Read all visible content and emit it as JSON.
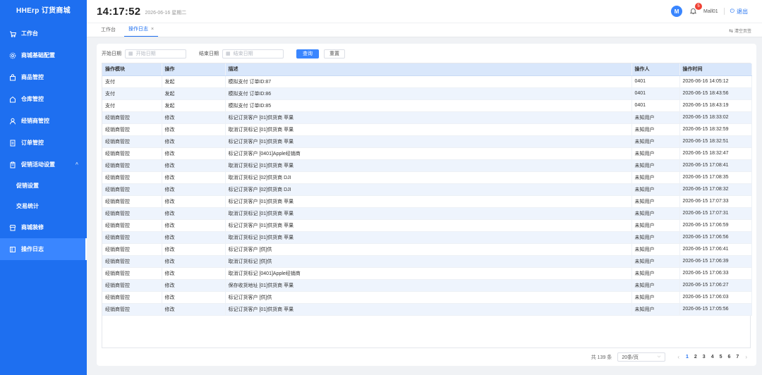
{
  "brand": "HHErp 订货商城",
  "sidebar": {
    "items": [
      {
        "label": "工作台",
        "icon": "cart-icon"
      },
      {
        "label": "商城基础配置",
        "icon": "gear-icon"
      },
      {
        "label": "商品管控",
        "icon": "bag-icon"
      },
      {
        "label": "仓库管控",
        "icon": "house-icon"
      },
      {
        "label": "经销商管控",
        "icon": "user-icon"
      },
      {
        "label": "订单管控",
        "icon": "document-icon"
      },
      {
        "label": "促销活动设置",
        "icon": "clipboard-icon",
        "caret": "^"
      },
      {
        "label": "促销设置"
      },
      {
        "label": "交易统计"
      },
      {
        "label": "商城装修",
        "icon": "store-icon"
      },
      {
        "label": "操作日志",
        "icon": "log-icon"
      }
    ]
  },
  "header": {
    "clock": "14:17:52",
    "date": "2026-06-16 星期二",
    "avatar_letter": "M",
    "notification_count": "5",
    "username": "Mall01",
    "logout_label": "退出"
  },
  "tabs": [
    {
      "label": "工作台"
    },
    {
      "label": "操作日志",
      "close": "×"
    }
  ],
  "clear_tabs_label": "清空页签",
  "filters": {
    "start_label": "开始日期",
    "start_placeholder": "开始日期",
    "end_label": "结束日期",
    "end_placeholder": "结束日期",
    "query_label": "查询",
    "reset_label": "重置"
  },
  "table": {
    "columns": [
      "操作模块",
      "操作",
      "描述",
      "操作人",
      "操作时间"
    ],
    "rows": [
      [
        "支付",
        "发起",
        "模拟支付 订单ID:87",
        "0401",
        "2026-06-16 14:05:12"
      ],
      [
        "支付",
        "发起",
        "模拟支付 订单ID:86",
        "0401",
        "2026-06-15 18:43:56"
      ],
      [
        "支付",
        "发起",
        "模拟支付 订单ID:85",
        "0401",
        "2026-06-15 18:43:19"
      ],
      [
        "经销商管控",
        "修改",
        "标记订货客户 [01]供货商 苹果",
        "未知用户",
        "2026-06-15 18:33:02"
      ],
      [
        "经销商管控",
        "修改",
        "取消订货标记 [01]供货商 苹果",
        "未知用户",
        "2026-06-15 18:32:59"
      ],
      [
        "经销商管控",
        "修改",
        "标记订货客户 [01]供货商 苹果",
        "未知用户",
        "2026-06-15 18:32:51"
      ],
      [
        "经销商管控",
        "修改",
        "标记订货客户 [0401]Apple经销商",
        "未知用户",
        "2026-06-15 18:32:47"
      ],
      [
        "经销商管控",
        "修改",
        "取消订货标记 [01]供货商 苹果",
        "未知用户",
        "2026-06-15 17:08:41"
      ],
      [
        "经销商管控",
        "修改",
        "取消订货标记 [02]供货商 DJI",
        "未知用户",
        "2026-06-15 17:08:35"
      ],
      [
        "经销商管控",
        "修改",
        "标记订货客户 [02]供货商 DJI",
        "未知用户",
        "2026-06-15 17:08:32"
      ],
      [
        "经销商管控",
        "修改",
        "标记订货客户 [01]供货商 苹果",
        "未知用户",
        "2026-06-15 17:07:33"
      ],
      [
        "经销商管控",
        "修改",
        "取消订货标记 [01]供货商 苹果",
        "未知用户",
        "2026-06-15 17:07:31"
      ],
      [
        "经销商管控",
        "修改",
        "标记订货客户 [01]供货商 苹果",
        "未知用户",
        "2026-06-15 17:06:59"
      ],
      [
        "经销商管控",
        "修改",
        "取消订货标记 [01]供货商 苹果",
        "未知用户",
        "2026-06-15 17:06:56"
      ],
      [
        "经销商管控",
        "修改",
        "标记订货客户 [供]供",
        "未知用户",
        "2026-06-15 17:06:41"
      ],
      [
        "经销商管控",
        "修改",
        "取消订货标记 [供]供",
        "未知用户",
        "2026-06-15 17:06:39"
      ],
      [
        "经销商管控",
        "修改",
        "取消订货标记 [0401]Apple经销商",
        "未知用户",
        "2026-06-15 17:06:33"
      ],
      [
        "经销商管控",
        "修改",
        "保存收货地址 [01]供货商 苹果",
        "未知用户",
        "2026-06-15 17:06:27"
      ],
      [
        "经销商管控",
        "修改",
        "标记订货客户 [供]供",
        "未知用户",
        "2026-06-15 17:06:03"
      ],
      [
        "经销商管控",
        "修改",
        "标记订货客户 [01]供货商 苹果",
        "未知用户",
        "2026-06-15 17:05:56"
      ]
    ]
  },
  "pagination": {
    "total": "共 139 条",
    "page_size": "20条/页",
    "prev": "‹",
    "next": "›",
    "pages": [
      "1",
      "2",
      "3",
      "4",
      "5",
      "6",
      "7"
    ],
    "current": "1"
  }
}
